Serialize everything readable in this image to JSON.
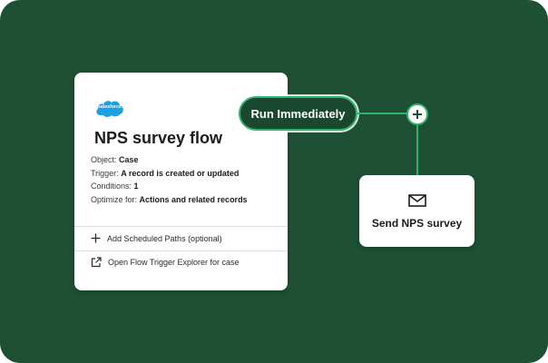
{
  "colors": {
    "background": "#1d5035",
    "accent": "#2fb56b",
    "card": "#ffffff",
    "brand_blue": "#1ba0e1"
  },
  "flow_card": {
    "logo_text": "salesforce",
    "title": "NPS survey flow",
    "properties": [
      {
        "label": "Object:",
        "value": "Case"
      },
      {
        "label": "Trigger:",
        "value": "A record is created or updated"
      },
      {
        "label": "Conditions:",
        "value": "1"
      },
      {
        "label": "Optimize for:",
        "value": "Actions and related records"
      }
    ],
    "actions": [
      {
        "icon": "plus-icon",
        "label": "Add Scheduled Paths (optional)"
      },
      {
        "icon": "open-external-icon",
        "label": "Open Flow Trigger Explorer for case"
      }
    ]
  },
  "run_pill": {
    "label": "Run Immediately"
  },
  "add_node": {
    "icon": "plus-icon"
  },
  "nps_card": {
    "icon": "mail-icon",
    "label": "Send NPS survey"
  }
}
